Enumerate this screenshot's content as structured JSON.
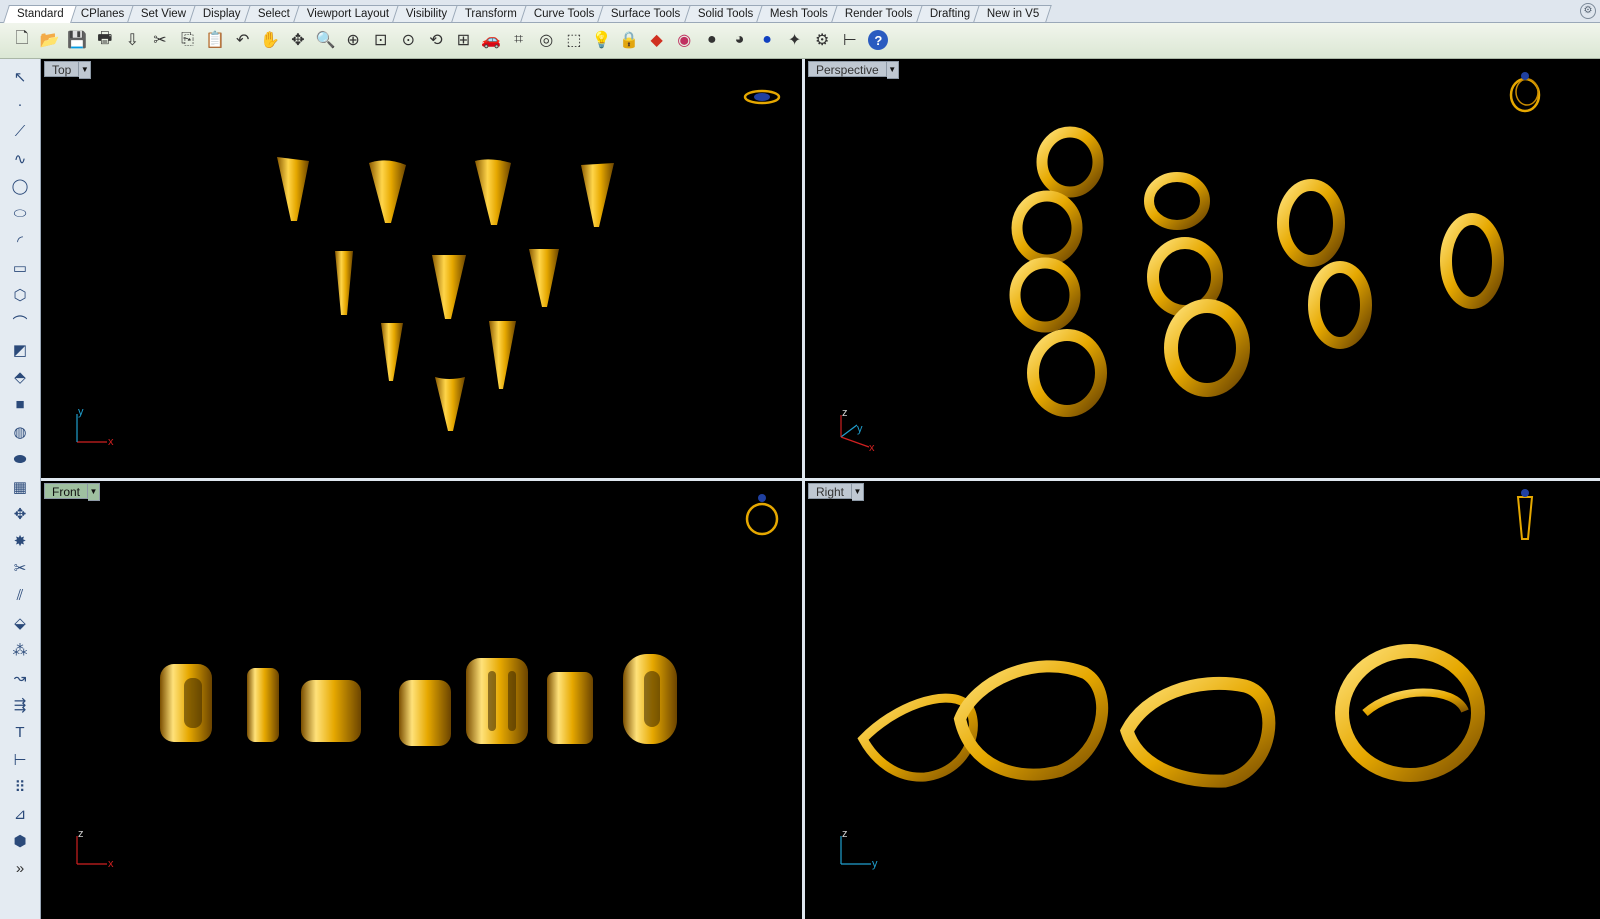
{
  "tabs": [
    {
      "label": "Standard",
      "active": true
    },
    {
      "label": "CPlanes"
    },
    {
      "label": "Set View"
    },
    {
      "label": "Display"
    },
    {
      "label": "Select"
    },
    {
      "label": "Viewport Layout"
    },
    {
      "label": "Visibility"
    },
    {
      "label": "Transform"
    },
    {
      "label": "Curve Tools"
    },
    {
      "label": "Surface Tools"
    },
    {
      "label": "Solid Tools"
    },
    {
      "label": "Mesh Tools"
    },
    {
      "label": "Render Tools"
    },
    {
      "label": "Drafting"
    },
    {
      "label": "New in V5"
    }
  ],
  "toolbar_icons": [
    "new-icon",
    "open-icon",
    "save-icon",
    "print-icon",
    "import-icon",
    "cut-icon",
    "copy-icon",
    "paste-icon",
    "undo-icon",
    "pan-icon",
    "move-view-icon",
    "zoom-icon",
    "zoom-window-icon",
    "zoom-extents-icon",
    "zoom-selected-icon",
    "rotate-view-icon",
    "four-viewports-icon",
    "car-icon",
    "cplane-icon",
    "snap-icon",
    "select-icon",
    "light-icon",
    "lock-icon",
    "layer-icon",
    "color-wheel-icon",
    "shaded-sphere-icon",
    "rendered-sphere-icon",
    "blue-sphere-icon",
    "render-icon",
    "settings-icon",
    "dimension-icon",
    "help-icon"
  ],
  "left_icons": [
    "select-arrow-icon",
    "point-icon",
    "polyline-icon",
    "curve-icon",
    "circle-icon",
    "ellipse-icon",
    "arc-icon",
    "rectangle-icon",
    "polygon-icon",
    "fillet-curve-icon",
    "surface-icon",
    "extrude-icon",
    "box-icon",
    "boolean-icon",
    "cylinder-icon",
    "mesh-icon",
    "transform-icon",
    "explode-icon",
    "trim-icon",
    "split-icon",
    "solid-edit-icon",
    "group-icon",
    "curve-tools-icon",
    "offset-icon",
    "text-icon",
    "dimension-icon",
    "array-icon",
    "analyze-icon",
    "render-icon",
    "more-icon"
  ],
  "viewports": {
    "top": {
      "label": "Top",
      "axis_1": "y",
      "axis_2": "x",
      "active": false
    },
    "perspective": {
      "label": "Perspective",
      "axis_1": "z",
      "axis_2": "y",
      "axis_3": "x",
      "active": false
    },
    "front": {
      "label": "Front",
      "axis_1": "z",
      "axis_2": "x",
      "active": true
    },
    "right": {
      "label": "Right",
      "axis_1": "z",
      "axis_2": "y",
      "active": false
    }
  },
  "colors": {
    "gold": "#e6a800",
    "gold_light": "#ffd54a",
    "gold_dark": "#8a5a00",
    "viewport_bg": "#000000",
    "axis_x": "#d02020",
    "axis_y": "#20a0d0"
  },
  "more_label": "»"
}
